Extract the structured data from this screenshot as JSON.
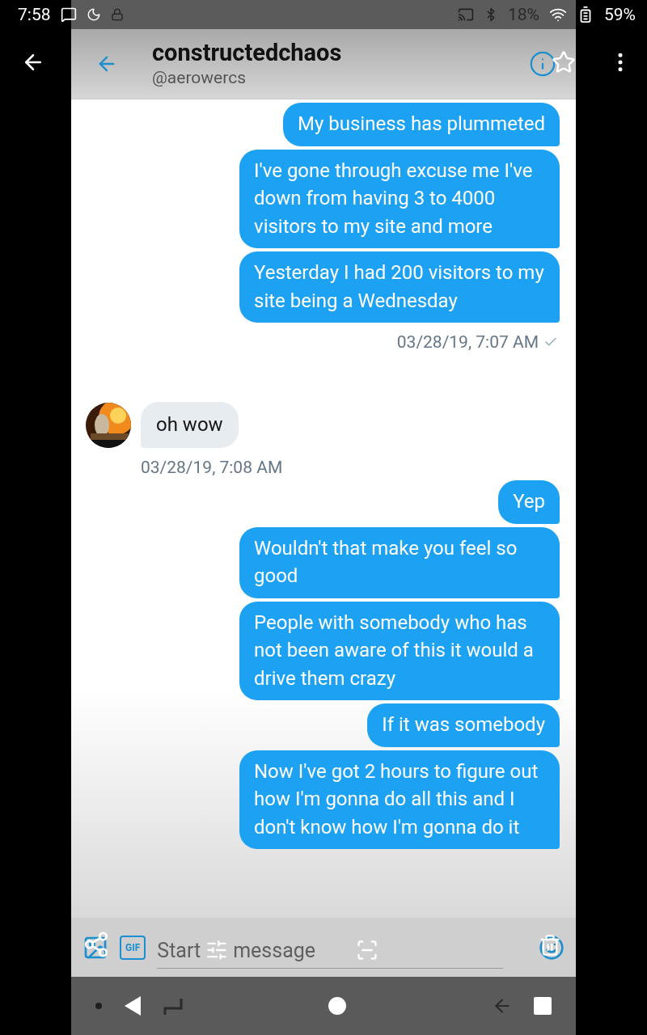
{
  "status_bar": {
    "time": "7:58",
    "inner_battery": "18%",
    "battery": "59%"
  },
  "header": {
    "name": "constructedchaos",
    "handle": "@aerowercs"
  },
  "messages": [
    {
      "kind": "sent",
      "text": "My business has plummeted"
    },
    {
      "kind": "sent",
      "text": "I've gone through excuse me I've down from having 3 to 4000 visitors to my site and more"
    },
    {
      "kind": "sent",
      "text": "Yesterday I had 200 visitors to my site being a Wednesday"
    },
    {
      "kind": "sent_time",
      "text": "03/28/19, 7:07 AM",
      "read": true
    },
    {
      "kind": "received",
      "text": "oh wow"
    },
    {
      "kind": "received_time",
      "text": "03/28/19, 7:08 AM"
    },
    {
      "kind": "sent",
      "text": "Yep"
    },
    {
      "kind": "sent",
      "text": "Wouldn't that  make you feel so good"
    },
    {
      "kind": "sent",
      "text": "People with somebody who has not been aware of this it would a drive them crazy"
    },
    {
      "kind": "sent",
      "text": "If it was somebody"
    },
    {
      "kind": "sent",
      "text": "Now I've got 2 hours to figure out how I'm gonna do all this and I don't know how I'm gonna do it"
    }
  ],
  "compose": {
    "placeholder_start": "Start",
    "placeholder_end": "message",
    "gif": "GIF"
  }
}
